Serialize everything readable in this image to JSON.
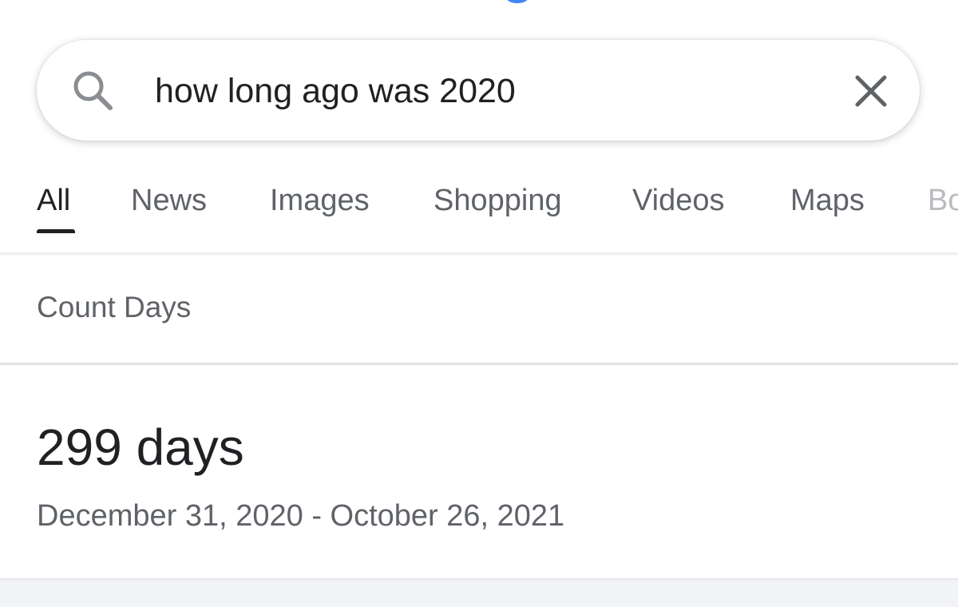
{
  "search": {
    "query": "how long ago was 2020",
    "search_icon": "search-icon",
    "clear_icon": "close-icon"
  },
  "tabs": [
    {
      "label": "All",
      "active": true
    },
    {
      "label": "News",
      "active": false
    },
    {
      "label": "Images",
      "active": false
    },
    {
      "label": "Shopping",
      "active": false
    },
    {
      "label": "Videos",
      "active": false
    },
    {
      "label": "Maps",
      "active": false
    },
    {
      "label": "Bo",
      "active": false
    }
  ],
  "card": {
    "title": "Count Days",
    "result": "299 days",
    "range": "December 31, 2020 - October 26, 2021"
  },
  "colors": {
    "text_primary": "#202124",
    "text_secondary": "#5f6368",
    "accent_blue": "#4285f4"
  }
}
